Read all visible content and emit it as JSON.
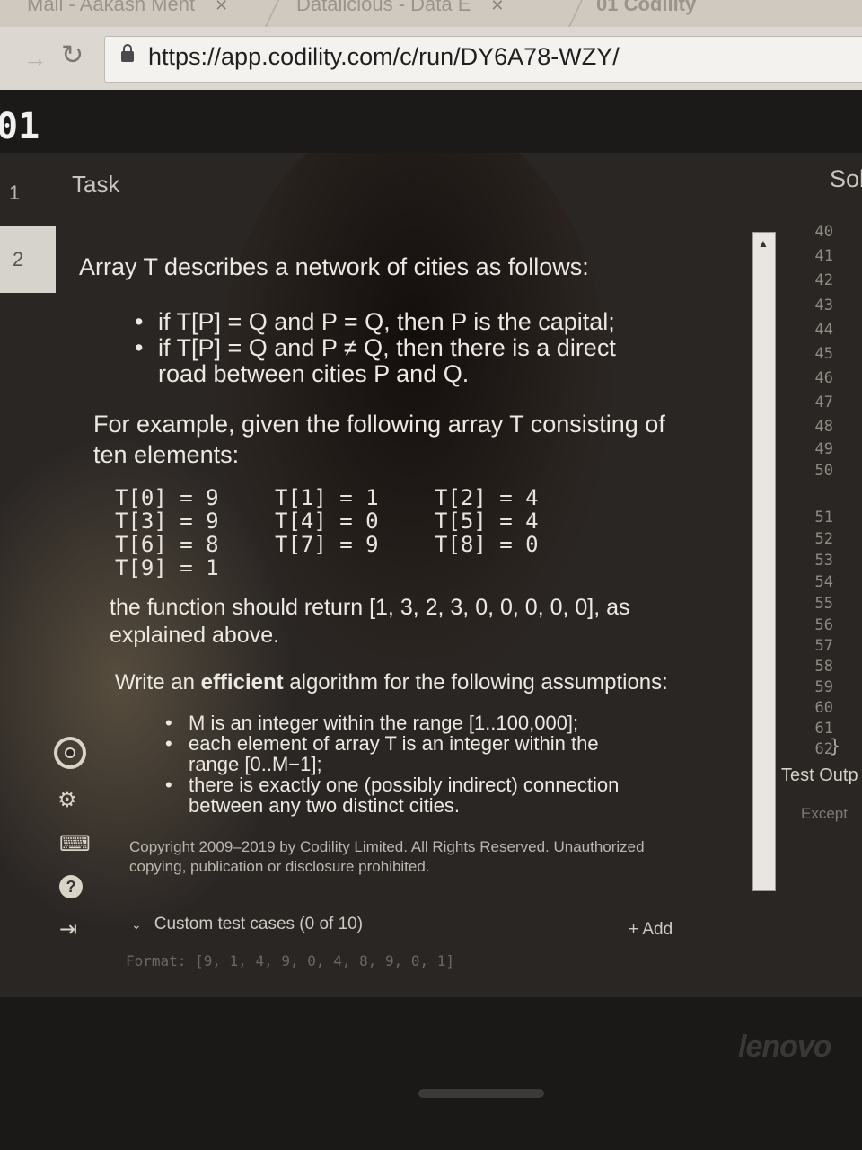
{
  "browser": {
    "tabs": [
      {
        "label": "Mail - Aakash Ment"
      },
      {
        "label": "Datalicious - Data E"
      },
      {
        "label": "01 Codility"
      }
    ],
    "url": "https://app.codility.com/c/run/DY6A78-WZY/"
  },
  "app": {
    "brand": "01",
    "task_numbers": [
      "1",
      "2"
    ],
    "task_label": "Task",
    "solution_label": "Sol"
  },
  "task": {
    "intro": "Array T describes a network of cities as follows:",
    "rules": [
      "if T[P] = Q and P = Q, then P is the capital;",
      "if T[P] = Q and P ≠ Q, then there is a direct road between cities P and Q."
    ],
    "example_intro": "For example, given the following array T consisting of ten elements:",
    "array_rows": [
      [
        "T[0] = 9",
        "T[1] = 1",
        "T[2] = 4"
      ],
      [
        "T[3] = 9",
        "T[4] = 0",
        "T[5] = 4"
      ],
      [
        "T[6] = 8",
        "T[7] = 9",
        "T[8] = 0"
      ],
      [
        "T[9] = 1"
      ]
    ],
    "return_text": "the function should return [1, 3, 2, 3, 0, 0, 0, 0, 0], as explained above.",
    "assumptions_intro_pre": "Write an ",
    "assumptions_intro_bold": "efficient",
    "assumptions_intro_post": " algorithm for the following assumptions:",
    "assumptions": [
      "M is an integer within the range [1..100,000];",
      "each element of array T is an integer within the range [0..M−1];",
      "there is exactly one (possibly indirect) connection between any two distinct cities."
    ],
    "copyright": "Copyright 2009–2019 by Codility Limited. All Rights Reserved. Unauthorized copying, publication or disclosure prohibited."
  },
  "custom_tests": {
    "label": "Custom test cases (0 of 10)",
    "add_label": "+ Add",
    "format_hint": "Format: [9, 1, 4, 9, 0, 4, 8, 9, 0, 1]"
  },
  "editor": {
    "line_numbers": [
      "40",
      "41",
      "42",
      "43",
      "44",
      "45",
      "46",
      "47",
      "48",
      "49",
      "50",
      "51",
      "52",
      "53",
      "54",
      "55",
      "56",
      "57",
      "58",
      "59",
      "60",
      "61",
      "62"
    ],
    "closing_brace": "}",
    "test_output_label": "Test Outp",
    "exception_label": "Except"
  },
  "laptop": {
    "brand": "lenovo"
  }
}
